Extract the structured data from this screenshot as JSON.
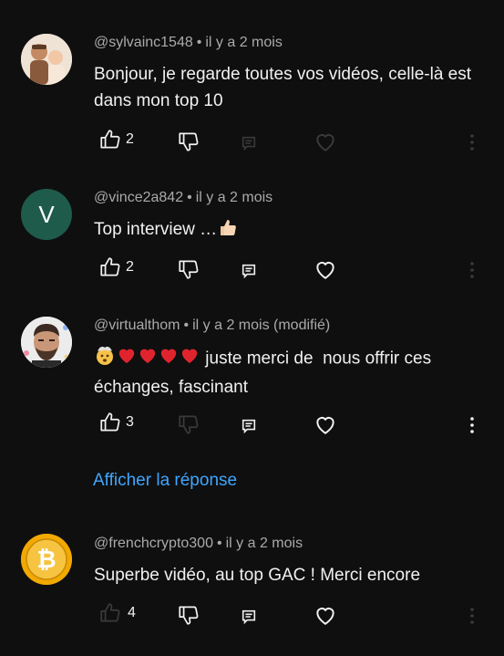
{
  "comments": [
    {
      "author": "@sylvainc1548",
      "time": "il y a 2 mois",
      "text": "Bonjour, je regarde toutes vos vidéos, celle-là est dans mon top 10",
      "likes": "2",
      "avatar_icon": "family-photo-avatar"
    },
    {
      "author": "@vince2a842",
      "time": "il y a 2 mois",
      "text": "Top interview …",
      "likes": "2",
      "avatar_letter": "V",
      "avatar_color": "#1e5b4b"
    },
    {
      "author": "@virtualthom",
      "time": "il y a 2 mois (modifié)",
      "text": "juste merci de  nous offrir ces échanges, fascinant",
      "likes": "3",
      "avatar_icon": "man-photo-avatar"
    },
    {
      "author": "@frenchcrypto300",
      "time": "il y a 2 mois",
      "text": "Superbe vidéo, au top GAC ! Merci encore",
      "likes": "4",
      "avatar_icon": "bitcoin-avatar"
    }
  ],
  "reply_link": "Afficher la réponse",
  "colors": {
    "link": "#3ea6ff",
    "background": "#0f0f0f",
    "meta": "#aaaaaa"
  }
}
